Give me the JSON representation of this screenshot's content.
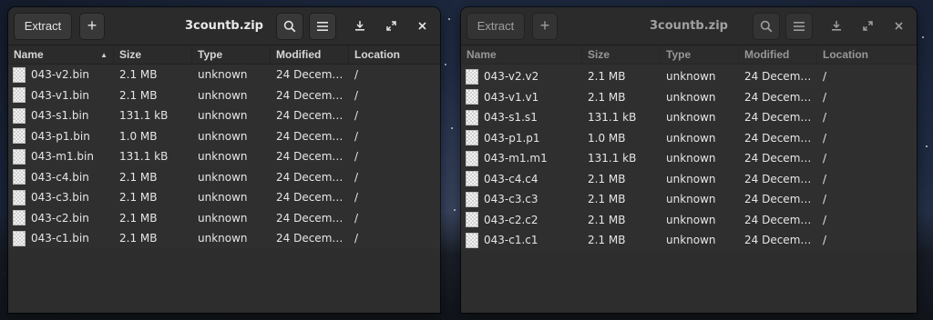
{
  "window_a": {
    "title": "3countb.zip",
    "extract_label": "Extract",
    "add_label": "+",
    "columns": [
      "Name",
      "Size",
      "Type",
      "Modified",
      "Location"
    ],
    "rows": [
      {
        "name": "043-v2.bin",
        "size": "2.1 MB",
        "type": "unknown",
        "modified": "24 December…",
        "location": "/"
      },
      {
        "name": "043-v1.bin",
        "size": "2.1 MB",
        "type": "unknown",
        "modified": "24 December…",
        "location": "/"
      },
      {
        "name": "043-s1.bin",
        "size": "131.1 kB",
        "type": "unknown",
        "modified": "24 December…",
        "location": "/"
      },
      {
        "name": "043-p1.bin",
        "size": "1.0 MB",
        "type": "unknown",
        "modified": "24 December…",
        "location": "/"
      },
      {
        "name": "043-m1.bin",
        "size": "131.1 kB",
        "type": "unknown",
        "modified": "24 December…",
        "location": "/"
      },
      {
        "name": "043-c4.bin",
        "size": "2.1 MB",
        "type": "unknown",
        "modified": "24 December…",
        "location": "/"
      },
      {
        "name": "043-c3.bin",
        "size": "2.1 MB",
        "type": "unknown",
        "modified": "24 December…",
        "location": "/"
      },
      {
        "name": "043-c2.bin",
        "size": "2.1 MB",
        "type": "unknown",
        "modified": "24 December…",
        "location": "/"
      },
      {
        "name": "043-c1.bin",
        "size": "2.1 MB",
        "type": "unknown",
        "modified": "24 December…",
        "location": "/"
      }
    ]
  },
  "window_b": {
    "title": "3countb.zip",
    "extract_label": "Extract",
    "add_label": "+",
    "columns": [
      "Name",
      "Size",
      "Type",
      "Modified",
      "Location"
    ],
    "rows": [
      {
        "name": "043-v2.v2",
        "size": "2.1 MB",
        "type": "unknown",
        "modified": "24 Decembe…",
        "location": "/"
      },
      {
        "name": "043-v1.v1",
        "size": "2.1 MB",
        "type": "unknown",
        "modified": "24 Decembe…",
        "location": "/"
      },
      {
        "name": "043-s1.s1",
        "size": "131.1 kB",
        "type": "unknown",
        "modified": "24 Decembe…",
        "location": "/"
      },
      {
        "name": "043-p1.p1",
        "size": "1.0 MB",
        "type": "unknown",
        "modified": "24 Decembe…",
        "location": "/"
      },
      {
        "name": "043-m1.m1",
        "size": "131.1 kB",
        "type": "unknown",
        "modified": "24 Decembe…",
        "location": "/"
      },
      {
        "name": "043-c4.c4",
        "size": "2.1 MB",
        "type": "unknown",
        "modified": "24 Decembe…",
        "location": "/"
      },
      {
        "name": "043-c3.c3",
        "size": "2.1 MB",
        "type": "unknown",
        "modified": "24 Decembe…",
        "location": "/"
      },
      {
        "name": "043-c2.c2",
        "size": "2.1 MB",
        "type": "unknown",
        "modified": "24 Decembe…",
        "location": "/"
      },
      {
        "name": "043-c1.c1",
        "size": "2.1 MB",
        "type": "unknown",
        "modified": "24 Decembe…",
        "location": "/"
      }
    ]
  },
  "icons": [
    "plus-icon",
    "search-icon",
    "menu-icon",
    "download-icon",
    "maximize-icon",
    "close-icon",
    "sort-arrow-icon",
    "file-icon"
  ],
  "colors": {
    "window_bg": "#2d2d2d",
    "headerbar_bg": "#2b2b2b",
    "button_bg": "#383838",
    "text": "#e6e6e6"
  }
}
